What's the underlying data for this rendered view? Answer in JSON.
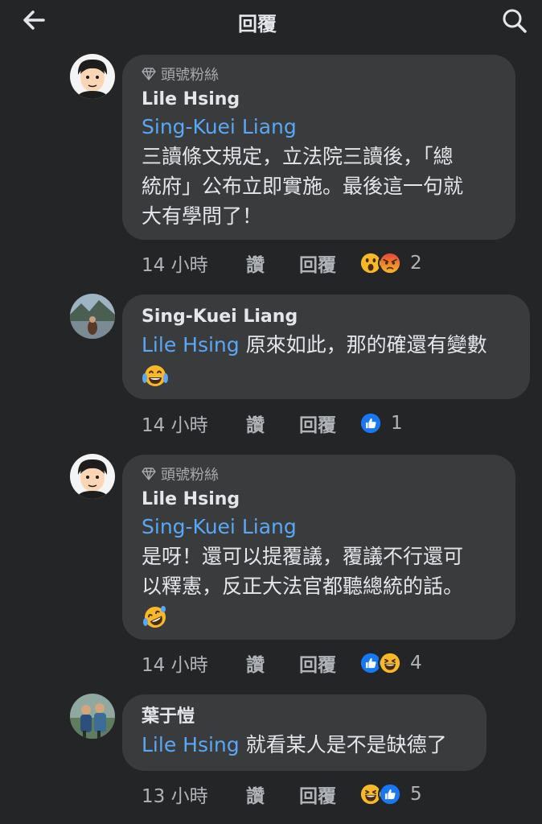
{
  "header": {
    "title": "回覆",
    "back_icon": "arrow-left-icon",
    "search_icon": "search-icon"
  },
  "comments": [
    {
      "badge": "頭號粉絲",
      "author": "Lile Hsing",
      "mention": "Sing-Kuei Liang",
      "text_line1": "三讀條文規定，立法院三讀後，「總",
      "text_line2": "統府」公布立即實施。最後這一句就",
      "text_line3": "大有學問了！",
      "time": "14 小時",
      "like": "讚",
      "reply": "回覆",
      "reactions": [
        "wow",
        "angry"
      ],
      "count": "2"
    },
    {
      "author": "Sing-Kuei Liang",
      "mention": "Lile Hsing",
      "text": "原來如此，那的確還有變數",
      "emoji": "laughing-tears-emoji",
      "time": "14 小時",
      "like": "讚",
      "reply": "回覆",
      "reactions": [
        "like"
      ],
      "count": "1"
    },
    {
      "badge": "頭號粉絲",
      "author": "Lile Hsing",
      "mention": "Sing-Kuei Liang",
      "text_line1": "是呀！還可以提覆議，覆議不行還可",
      "text_line2": "以釋憲，反正大法官都聽總統的話。",
      "emoji": "rolling-laughing-emoji",
      "time": "14 小時",
      "like": "讚",
      "reply": "回覆",
      "reactions": [
        "like",
        "haha"
      ],
      "count": "4"
    },
    {
      "author": "葉于愷",
      "mention": "Lile Hsing",
      "text": "就看某人是不是缺德了",
      "time": "13 小時",
      "like": "讚",
      "reply": "回覆",
      "reactions": [
        "haha",
        "like"
      ],
      "count": "5"
    }
  ],
  "colors": {
    "background": "#242526",
    "bubble": "#3a3b3c",
    "mention": "#5aa7f5",
    "text": "#e4e6eb",
    "meta": "#b0b3b8",
    "like_blue": "#1877f2",
    "angry_red": "#e4453a",
    "emoji_yellow": "#f7b928"
  }
}
